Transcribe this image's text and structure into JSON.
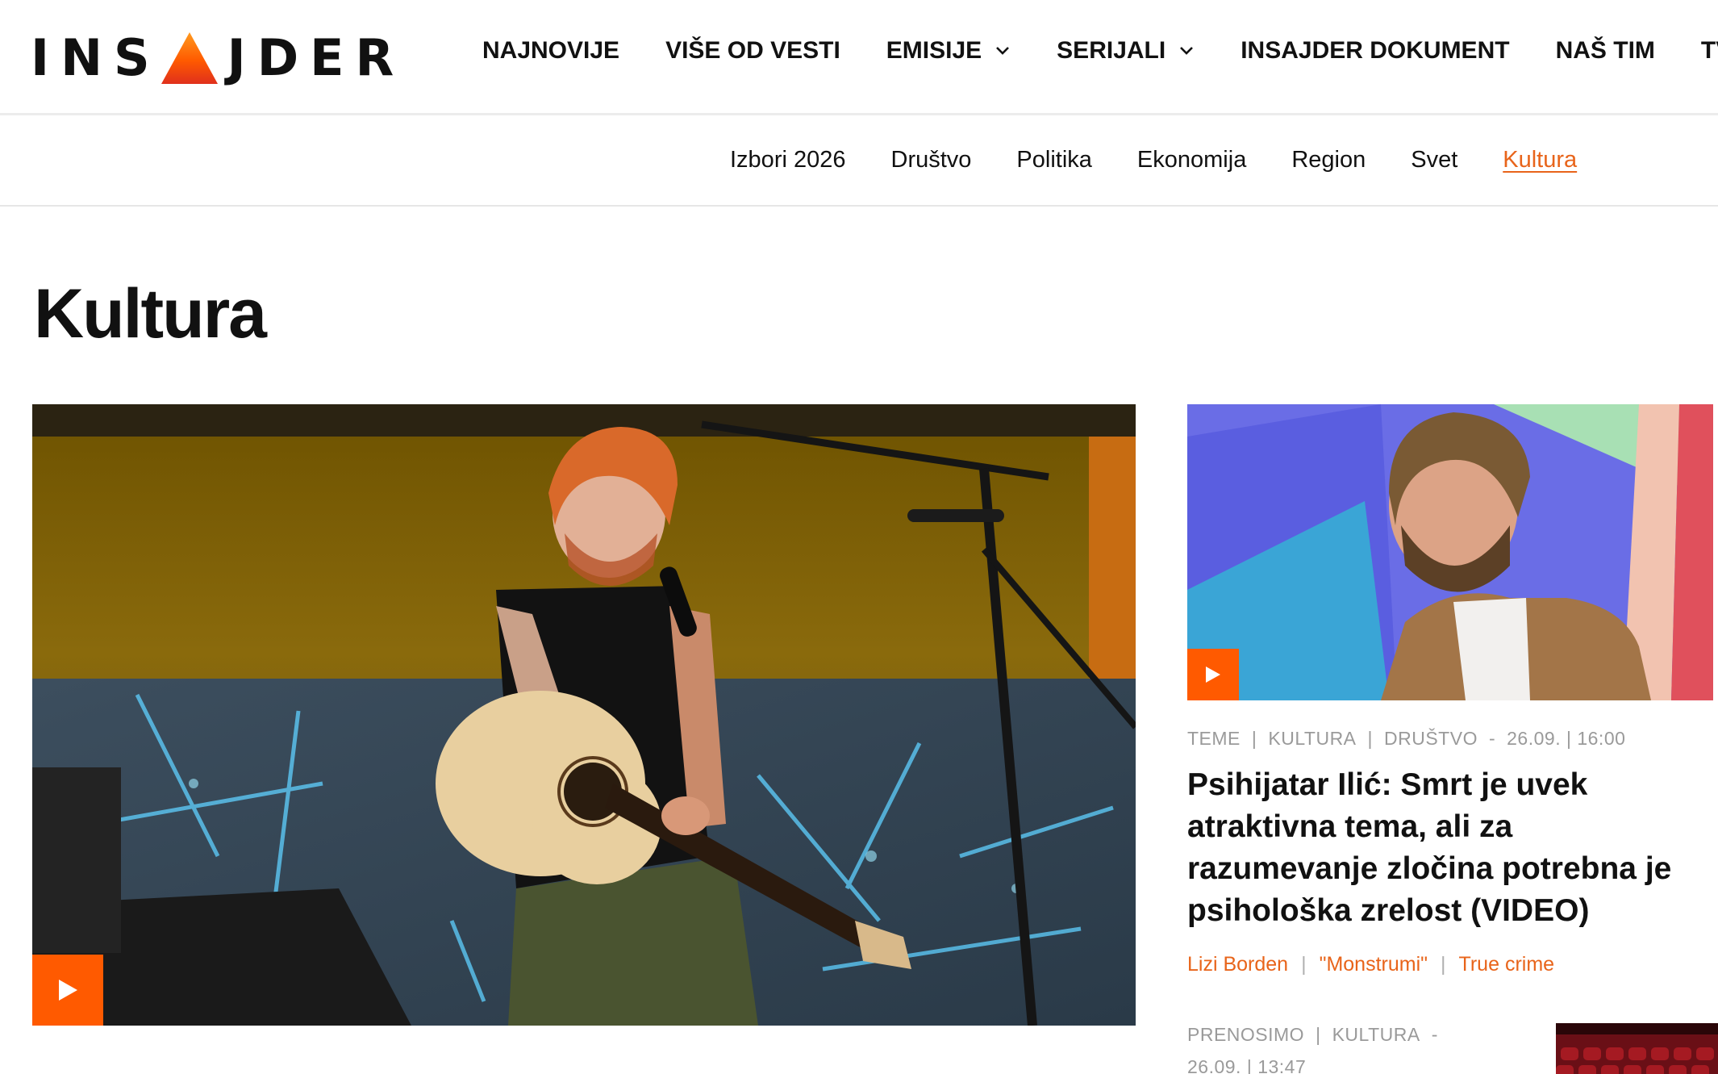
{
  "logo": {
    "left": "INS",
    "right": "JDER"
  },
  "main_nav": {
    "items": [
      {
        "label": "NAJNOVIJE",
        "dropdown": false
      },
      {
        "label": "VIŠE OD VESTI",
        "dropdown": false
      },
      {
        "label": "EMISIJE",
        "dropdown": true
      },
      {
        "label": "SERIJALI",
        "dropdown": true
      },
      {
        "label": "INSAJDER DOKUMENT",
        "dropdown": false
      },
      {
        "label": "NAŠ TIM",
        "dropdown": false
      },
      {
        "label": "TV N",
        "dropdown": false
      }
    ]
  },
  "sub_nav": {
    "items": [
      "Izbori 2026",
      "Društvo",
      "Politika",
      "Ekonomija",
      "Region",
      "Svet",
      "Kultura"
    ],
    "active": "Kultura"
  },
  "page": {
    "title": "Kultura"
  },
  "side_article": {
    "meta": [
      "TEME",
      "KULTURA",
      "DRUŠTVO"
    ],
    "date": "26.09. | 16:00",
    "headline": "Psihijatar Ilić: Smrt je uvek atraktivna tema, ali za razumevanje zločina potrebna je psihološka zrelost (VIDEO)",
    "tags": [
      "Lizi Borden",
      "\"Monstrumi\"",
      "True crime"
    ]
  },
  "second_article": {
    "meta": [
      "PRENOSIMO",
      "KULTURA"
    ],
    "date": "26.09. | 13:47"
  },
  "colors": {
    "accent": "#e8641a",
    "play": "#ff5a00"
  }
}
